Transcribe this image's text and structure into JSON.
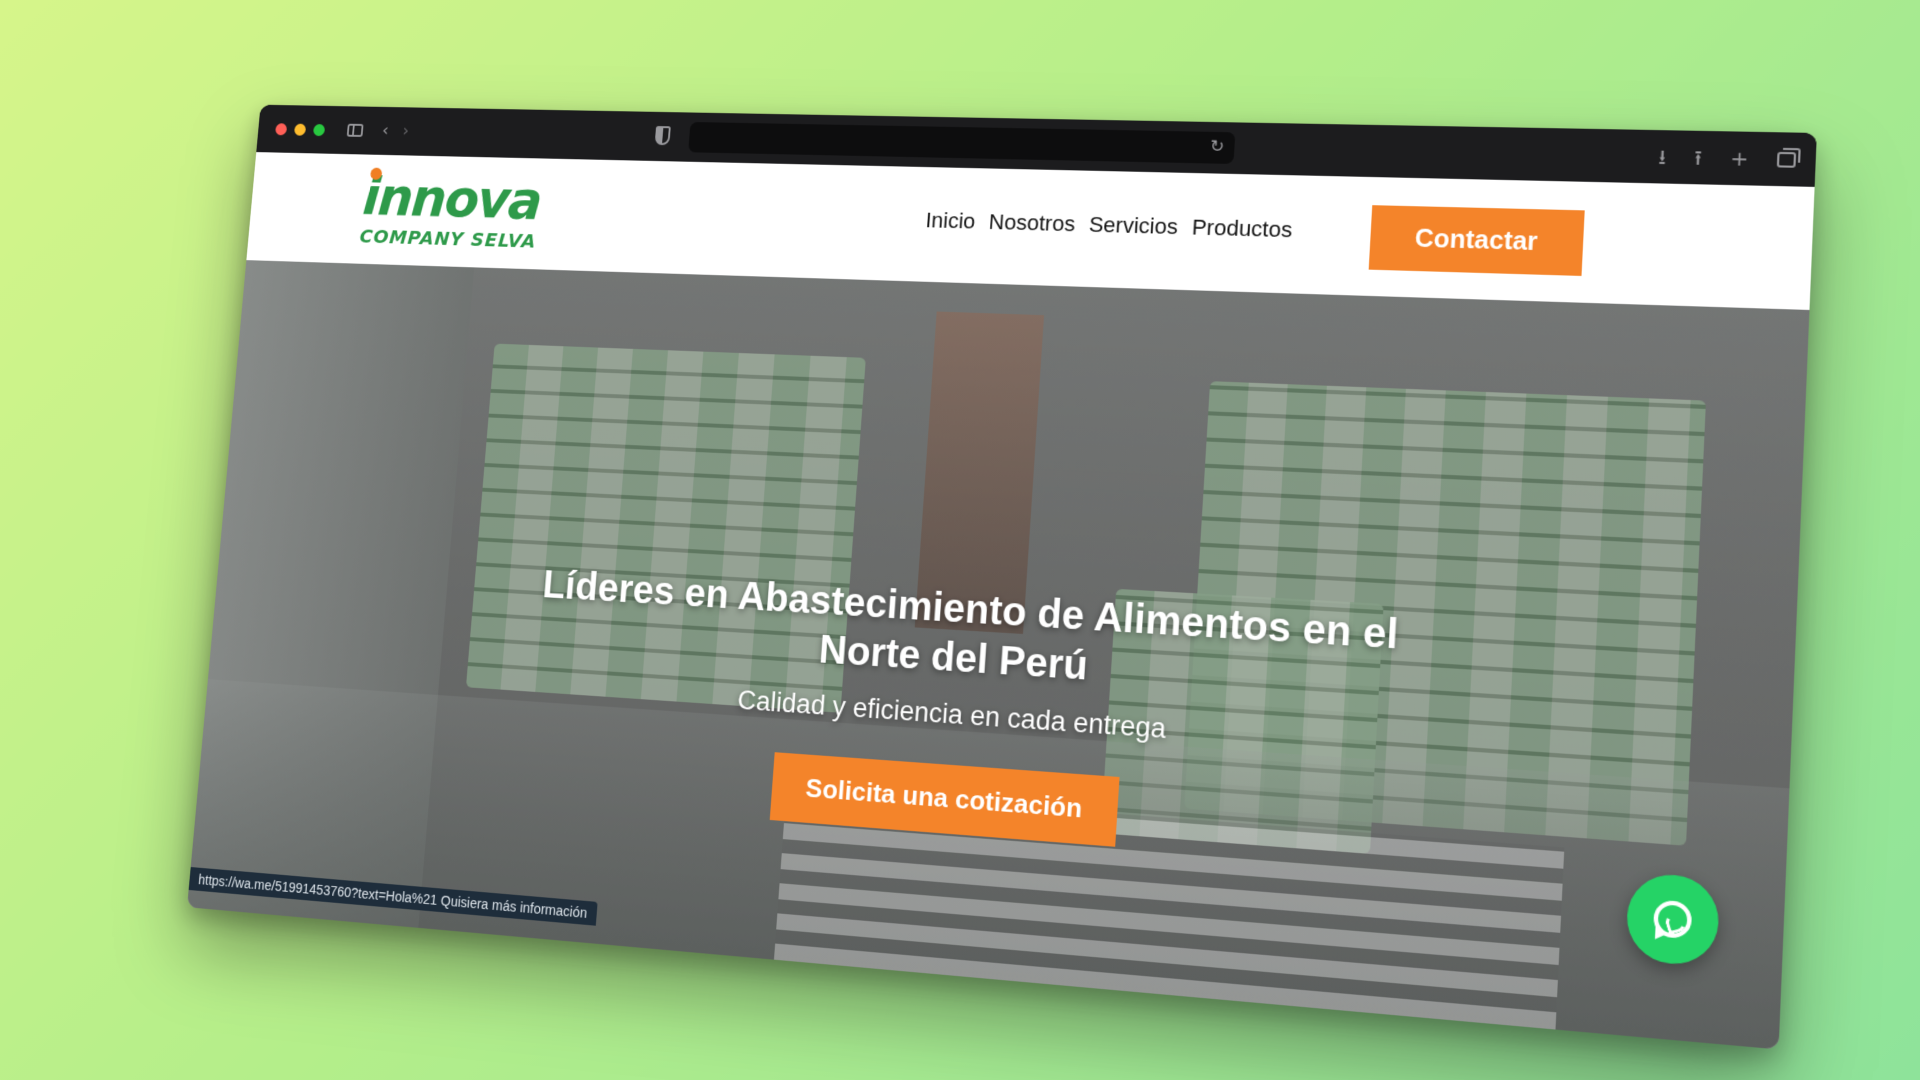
{
  "site": {
    "brand": {
      "logo_word": "innova",
      "logo_sub": "COMPANY SELVA"
    },
    "nav": [
      {
        "label": "Inicio"
      },
      {
        "label": "Nosotros"
      },
      {
        "label": "Servicios"
      },
      {
        "label": "Productos"
      }
    ],
    "contact_button": "Contactar",
    "hero": {
      "title": "Líderes en Abastecimiento de Alimentos en el Norte del Perú",
      "subtitle": "Calidad y eficiencia en cada entrega",
      "cta": "Solicita una cotización"
    },
    "status_bar_link": "https://wa.me/51991453760?text=Hola%21 Quisiera más información"
  },
  "icons": {
    "sidebar": "sidebar-icon",
    "back": "chevron-left-icon",
    "forward": "chevron-right-icon",
    "privacy": "shield-icon",
    "reload": "reload-icon",
    "download": "download-icon",
    "share": "share-icon",
    "new_tab": "plus-icon",
    "tabs": "tabs-overview-icon",
    "whatsapp": "whatsapp-icon"
  },
  "colors": {
    "brand_green": "#2e9a4a",
    "accent_orange": "#f4842a",
    "whatsapp_green": "#25d366",
    "backdrop_start": "#d6f58a",
    "backdrop_end": "#8ee39a"
  }
}
